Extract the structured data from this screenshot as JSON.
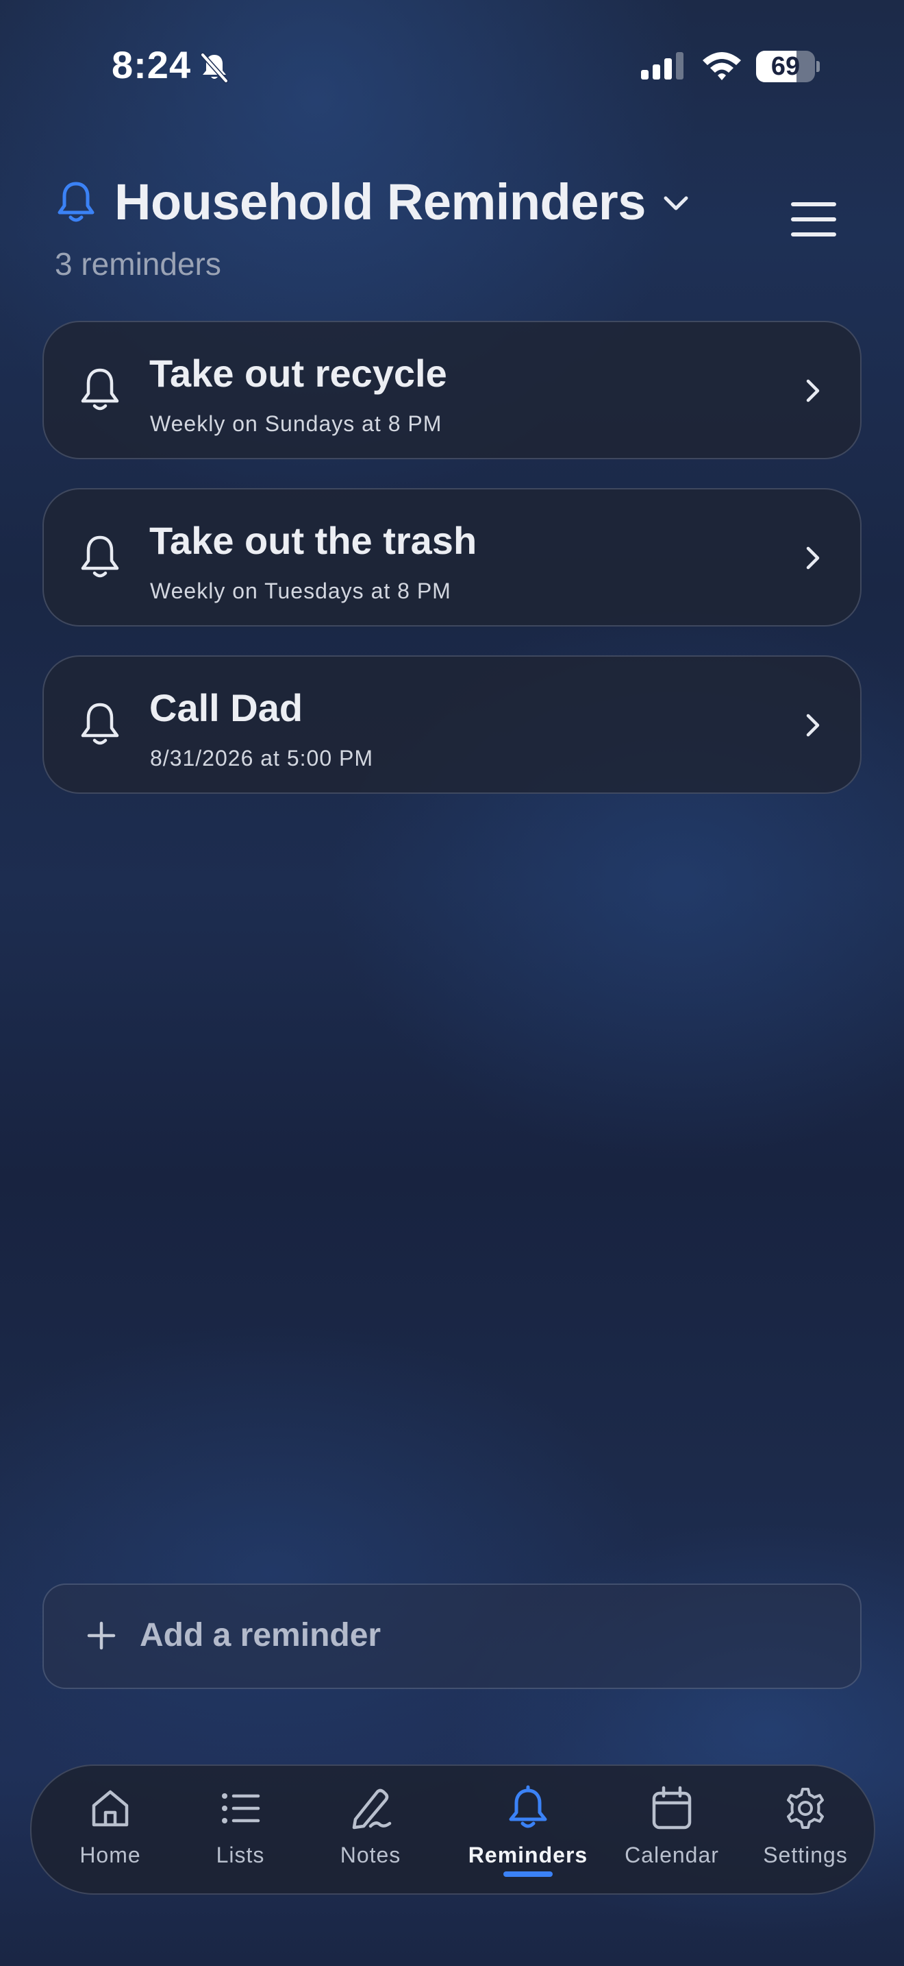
{
  "status_bar": {
    "time": "8:24",
    "battery": "69",
    "battery_level": 0.69
  },
  "header": {
    "title": "Household Reminders",
    "subtitle": "3 reminders"
  },
  "reminders": [
    {
      "title": "Take out recycle",
      "schedule": "Weekly on Sundays at 8 PM"
    },
    {
      "title": "Take out the trash",
      "schedule": "Weekly on Tuesdays at 8 PM"
    },
    {
      "title": "Call Dad",
      "schedule": "8/31/2026 at 5:00 PM"
    }
  ],
  "add_reminder": {
    "label": "Add a reminder"
  },
  "tabs": [
    {
      "label": "Home",
      "icon": "home-icon",
      "active": false
    },
    {
      "label": "Lists",
      "icon": "list-icon",
      "active": false
    },
    {
      "label": "Notes",
      "icon": "pencil-icon",
      "active": false
    },
    {
      "label": "Reminders",
      "icon": "bell-icon",
      "active": true
    },
    {
      "label": "Calendar",
      "icon": "calendar-icon",
      "active": false
    },
    {
      "label": "Settings",
      "icon": "gear-icon",
      "active": false
    }
  ],
  "colors": {
    "accent": "#3b82f6",
    "card_background": "#1e2434",
    "text_primary": "#eceef3",
    "text_secondary": "#9aa3b5"
  }
}
